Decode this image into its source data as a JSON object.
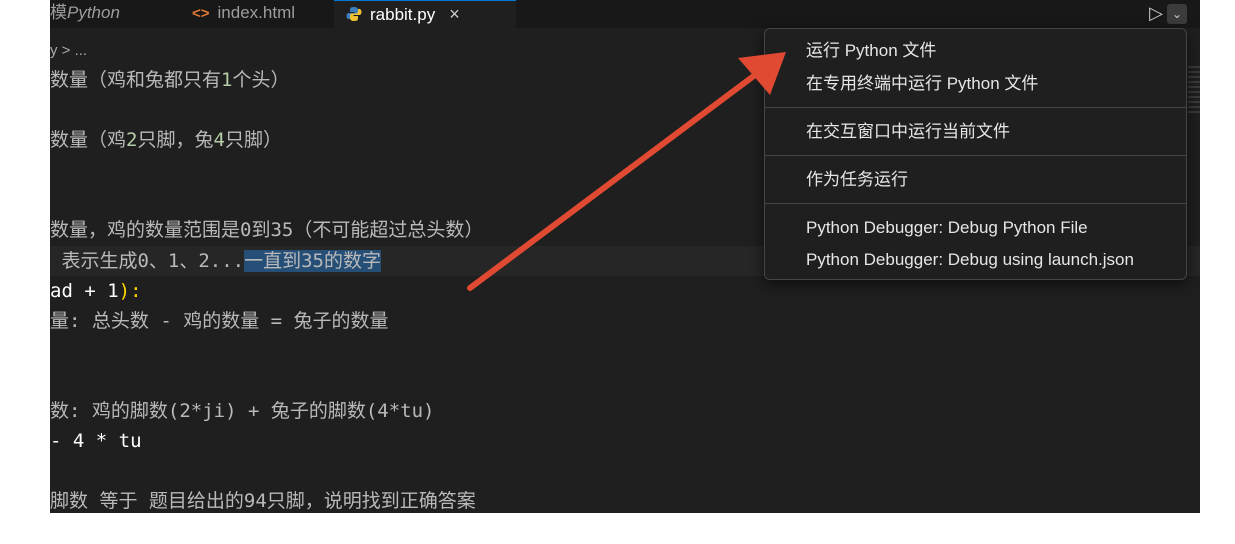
{
  "tabs": [
    {
      "icon": "python-file-icon",
      "label": "Python",
      "prefix": "模"
    },
    {
      "icon": "html-file-icon",
      "glyph": "<>",
      "label": "index.html"
    },
    {
      "icon": "python-file-icon",
      "label": "rabbit.py",
      "close": "×"
    }
  ],
  "toolbar": {
    "run_glyph": "▷",
    "chevron_glyph": "⌵"
  },
  "breadcrumb": "y > ...",
  "code_lines": [
    "数量（鸡和兔都只有",
    "1",
    "个头）",
    "数量（鸡",
    "2",
    "只脚，兔",
    "4",
    "只脚）",
    "数量，鸡的数量范围是0到35（不可能超过总头数）",
    "表示生成",
    "0、1、2...",
    "一直到35的数字",
    "ad + 1",
    "):",
    "量: 总头数 - 鸡的数量 = 兔子的数量",
    "数: 鸡的脚数(2*ji) + 兔子的脚数(4*tu)",
    "- 4 * tu",
    "脚数 等于 题目给出的94只脚，说明找到正确答案"
  ],
  "context_menu": {
    "items": [
      "运行 Python 文件",
      "在专用终端中运行 Python 文件",
      "在交互窗口中运行当前文件",
      "作为任务运行",
      "Python Debugger: Debug Python File",
      "Python Debugger: Debug using launch.json"
    ]
  },
  "colors": {
    "arrow": "#e04a32",
    "accent": "#0078d4"
  }
}
